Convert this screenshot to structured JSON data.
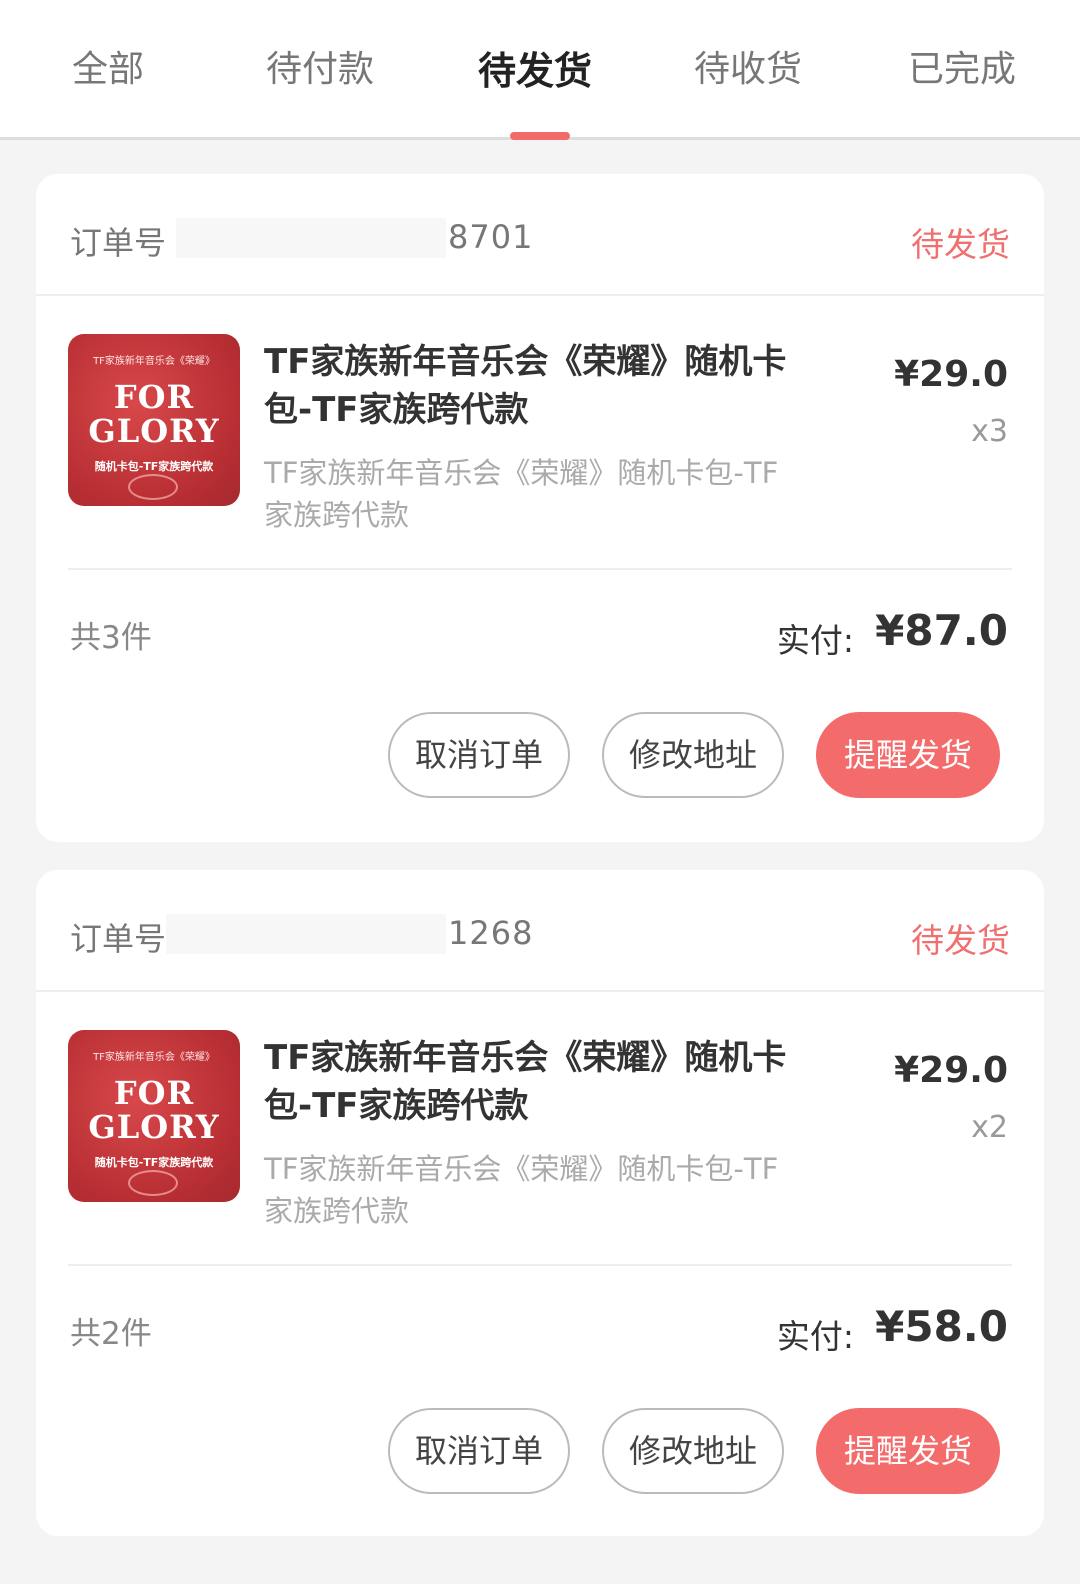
{
  "tabs": [
    {
      "label": "全部"
    },
    {
      "label": "待付款"
    },
    {
      "label": "待发货"
    },
    {
      "label": "待收货"
    },
    {
      "label": "已完成"
    }
  ],
  "active_tab": "待发货",
  "orders": [
    {
      "order_label": "订单号",
      "order_number_suffix": "8701",
      "status": "待发货",
      "product": {
        "thumbnail": {
          "top_text": "TF家族新年音乐会《荣耀》",
          "main_text": "FOR GLORY",
          "sub_text": "随机卡包-TF家族跨代款"
        },
        "title": "TF家族新年音乐会《荣耀》随机卡包-TF家族跨代款",
        "description": "TF家族新年音乐会《荣耀》随机卡包-TF家族跨代款",
        "price": "¥29.0",
        "quantity": "x3"
      },
      "count_text": "共3件",
      "paid_label": "实付:",
      "paid_amount": "¥87.0",
      "buttons": {
        "cancel": "取消订单",
        "address": "修改地址",
        "remind": "提醒发货"
      }
    },
    {
      "order_label": "订单号",
      "order_number_suffix": "1268",
      "status": "待发货",
      "product": {
        "thumbnail": {
          "top_text": "TF家族新年音乐会《荣耀》",
          "main_text": "FOR GLORY",
          "sub_text": "随机卡包-TF家族跨代款"
        },
        "title": "TF家族新年音乐会《荣耀》随机卡包-TF家族跨代款",
        "description": "TF家族新年音乐会《荣耀》随机卡包-TF家族跨代款",
        "price": "¥29.0",
        "quantity": "x2"
      },
      "count_text": "共2件",
      "paid_label": "实付:",
      "paid_amount": "¥58.0",
      "buttons": {
        "cancel": "取消订单",
        "address": "修改地址",
        "remind": "提醒发货"
      }
    }
  ],
  "colors": {
    "accent": "#f46b6b",
    "status": "#f07070",
    "background": "#f4f4f4"
  }
}
